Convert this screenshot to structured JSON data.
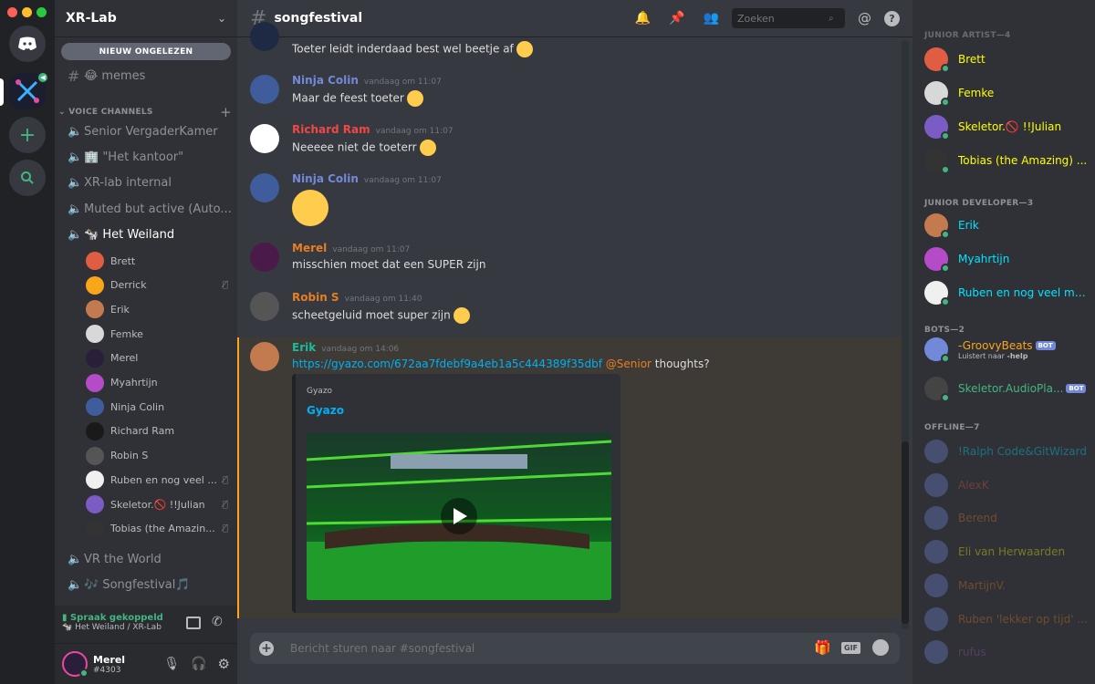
{
  "server": {
    "name": "XR-Lab"
  },
  "new_unread": "NIEUW ONGELEZEN",
  "text_channels": [
    {
      "icon": "hash",
      "name": "😂 memes"
    }
  ],
  "voice_category": "VOICE CHANNELS",
  "voice_channels": [
    {
      "name": "Senior VergaderKamer"
    },
    {
      "name": "🏢 \"Het kantoor\""
    },
    {
      "name": "XR-lab internal"
    },
    {
      "name": "Muted but active (Auto..."
    },
    {
      "name": "🐄 Het Weiland"
    }
  ],
  "voice_users": [
    {
      "name": "Brett",
      "muted": false,
      "color": "#e05d44"
    },
    {
      "name": "Derrick",
      "muted": true,
      "color": "#faa61a"
    },
    {
      "name": "Erik",
      "muted": false,
      "color": "#c47a4f"
    },
    {
      "name": "Femke",
      "muted": false,
      "color": "#d8d8d8"
    },
    {
      "name": "Merel",
      "muted": false,
      "color": "#2b1e3a"
    },
    {
      "name": "Myahrtijn",
      "muted": false,
      "color": "#b64bc7"
    },
    {
      "name": "Ninja Colin",
      "muted": false,
      "color": "#3f5d9c"
    },
    {
      "name": "Richard Ram",
      "muted": false,
      "color": "#1a1a1a"
    },
    {
      "name": "Robin S",
      "muted": false,
      "color": "#555555"
    },
    {
      "name": "Ruben en nog veel ...",
      "muted": true,
      "color": "#f0f0f0"
    },
    {
      "name": "Skeletor.🚫 !!Julian",
      "muted": true,
      "color": "#7b5cc4"
    },
    {
      "name": "Tobias (the Amazin...",
      "muted": true,
      "color": "#333333"
    }
  ],
  "voice_channels_after": [
    {
      "name": "VR the World"
    },
    {
      "name": "🎶 Songfestival🎵"
    }
  ],
  "voice_status": {
    "title": "Spraak gekoppeld",
    "sub": "🐄 Het Weiland / XR-Lab"
  },
  "user": {
    "name": "Merel",
    "tag": "#4303"
  },
  "channel": {
    "name": "songfestival",
    "search_placeholder": "Zoeken"
  },
  "messages": [
    {
      "author": "",
      "time": "",
      "text": "Toeter leidt inderdaad best wel beetje af",
      "color": "#ffffff",
      "emoji": true
    },
    {
      "author": "Ninja Colin",
      "time": "vandaag om 11:07",
      "text": "Maar de feest toeter",
      "color": "#7289da",
      "emoji": true
    },
    {
      "author": "Richard Ram",
      "time": "vandaag om 11:07",
      "text": "Neeeee niet de toeterr",
      "color": "#f04747",
      "emoji": true
    },
    {
      "author": "Ninja Colin",
      "time": "vandaag om 11:07",
      "text": "",
      "color": "#7289da",
      "emoji": false
    },
    {
      "author": "Merel",
      "time": "vandaag om 11:07",
      "text": "misschien moet dat een SUPER zijn",
      "color": "#e67e22",
      "emoji": false
    },
    {
      "author": "Robin S",
      "time": "vandaag om 11:40",
      "text": "scheetgeluid moet super zijn",
      "color": "#e67e22",
      "emoji": true
    },
    {
      "author": "Erik",
      "time": "vandaag om 14:06",
      "text": "",
      "color": "#1abc9c",
      "emoji": false
    }
  ],
  "erik_msg": {
    "link": "https://gyazo.com/672aa7fdebf9a4eb1a5c444389f35dbf",
    "mention": "@Senior",
    "rest": " thoughts?"
  },
  "embed": {
    "provider": "Gyazo",
    "title": "Gyazo"
  },
  "chat_placeholder": "Bericht sturen naar #songfestival",
  "gif_label": "GIF",
  "member_groups": [
    {
      "header": "JUNIOR ARTIST—4",
      "color": "#ffff00",
      "members": [
        "Brett",
        "Femke",
        "Skeletor.🚫 !!Julian",
        "Tobias (the Amazing) ..."
      ]
    },
    {
      "header": "JUNIOR DEVELOPER—3",
      "color": "#00e5ff",
      "members": [
        "Erik",
        "Myahrtijn",
        "Ruben en nog veel meer"
      ]
    }
  ],
  "bots_header": "BOTS—2",
  "bots": [
    {
      "name": "-GroovyBeats",
      "sub_prefix": "Luistert naar ",
      "sub_bold": "-help"
    },
    {
      "name": "Skeletor.AudioPla...",
      "sub_prefix": "",
      "sub_bold": ""
    }
  ],
  "bot_tag": "BOT",
  "offline_header": "OFFLINE—7",
  "offline": [
    {
      "name": "!Ralph Code&GitWizard",
      "color": "#00e5ff"
    },
    {
      "name": "AlexK",
      "color": "#e05d44"
    },
    {
      "name": "Berend",
      "color": "#e67e22"
    },
    {
      "name": "Eli van Herwaarden",
      "color": "#ffff00"
    },
    {
      "name": "MartijnV.",
      "color": "#e67e22"
    },
    {
      "name": "Ruben 'lekker op tijd' ...",
      "color": "#e67e22"
    },
    {
      "name": "rufus",
      "color": "#9b59b6"
    }
  ]
}
